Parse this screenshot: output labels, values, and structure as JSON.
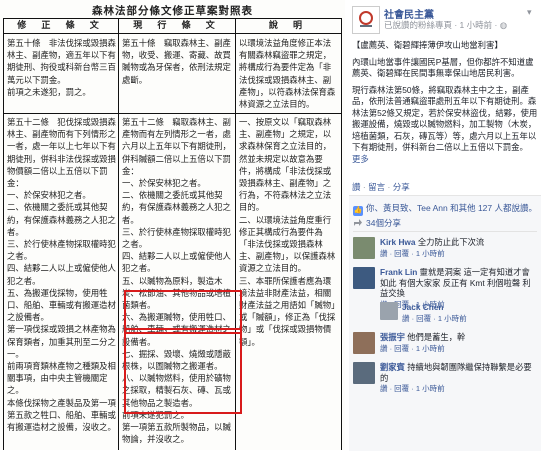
{
  "document": {
    "title": "森林法部分條文修正草案對照表",
    "headers": [
      "修 正 條 文",
      "現 行 條 文",
      "說  明"
    ],
    "row1": {
      "revised": "第五十條　非法伐採或毀損森林主、副產物，適五年以下有期徒刑、拘役或科新台幣三百萬元以下罰金。\n前項之未遂犯，罰之。",
      "current": "第五十條　竊取森林主、副產物，收受、搬運、寄藏、故買贓物或為牙保者，依刑法規定處斷。",
      "note": "以環境法益角度修正本法有關森林竊盜罪之規定，將構成行為要件定為「非法伐採或毀損森林主、副產物」，以符森林法保育森林資源之立法目的。"
    },
    "row2": {
      "revised": "第五十二條　犯伐採或毀損森林主、副產物而有下列情形之一者，處一年以上七年以下有期徒刑，併科非法伐採或毀損物價額二倍以上五倍以下罰金：\n一、於保安林犯之者。\n二、依機關之委託或其他契約，有保護森林義務之人犯之者。\n三、於行使林產物採取權時犯之者。\n四、結夥二人以上或僱使他人犯之者。\n五、為搬運伐採物，使用牲口、船舶、車輛或有搬運造材之設備者。\n第一項伐採或毀損之林產物為保育類者，加重其刑至二分之一。\n前兩項育類林產物之種類及相關事項，由中央主管機關定之。\n本條伐採物之產製品及第一項第五款之牲口、船舶、車輛或有搬運造材之設備，沒收之。",
      "current": "第五十二條　竊取森林主、副產物而有左列情形之一者，處六月以上五年以下有期徒刑，併科贓額二倍以上五倍以下罰金：\n一、於保安林犯之者。\n二、依機關之委託或其他契約，有保護森林義務之人犯之者。\n三、於行使林產物採取權時犯之者。\n四、結夥二人以上或僱使他人犯之者。\n五、以贓物為原料，製造木炭、松節油、其他物品或培植菌類者。\n六、為搬運贓物，使用牲口、船舶、車輛，或有搬運造材之設備者。\n七、掘採、毀壞、燒燬或隱蔽根株，以圖贓物之搬運者。\n八、以贓物燃料，使用於礦物之採取，精製石灰、磚、瓦或其他物品之製造者。\n前項未遂犯罰之。\n第一項第五款所製物品，以贓物論，并沒收之。",
      "note": "一、按原文以「竊取森林主、副產物」之規定，以求森林保育之立法目的，然並未規定以故意為要件，將構成「非法伐採或毀損森林主、副產物」之行為，不符森林法之立法目的。\n二、以環境法益角度重行修正其構成行為要件為「非法伐採或毀損森林主、副產物」，以保護森林資源之立法目的。\n三、本罪所保護者應為環境法益非財產法益，相關財產法益之用語如「贓物」或「贓額」，修正為「伐採物」或「伐採或毀損物價額」。"
    }
  },
  "post": {
    "page_name": "社會民主黨",
    "meta": "已說讚的粉絲專頁 · 1 小時前 · ",
    "time_icon": "globe-icon",
    "paragraphs": [
      "【盧薦英、衛碧輝捧薄伊攻山地當利害】",
      "內環山地當事件讓國民P基層，但你都許不知道盧薦英、衛碧輝在民間事無辜保山地居民利害。",
      "現行森林法第50條，將竊取森林主中之主，副產品，依刑法普通竊盜罪處刑五年以下有期徒刑。森林法第52條又規定，若於保安林盜伐，結夥，使用搬運設備，燒毀或以贓物燃料，加工製物（木炭，培植菌類，石灰，磚瓦等）等，處六月以上五年以下有期徒刑，併科新台二倍以上五倍以下罰金。"
    ],
    "more_label": "更多",
    "actions": [
      "讚",
      "留言",
      "分享"
    ],
    "likes_text": "你、黃貝致、Tee Ann 和其他 127 人都說讚。",
    "shares_text": "34個分享",
    "comments": [
      {
        "name": "Kirk Hwa",
        "text": "全力防止此下次流",
        "meta": "讚 · 回覆 · 1 小時前"
      },
      {
        "name": "Frank Lin",
        "text": "靈就是洞案 這一定有知道才會如此 有個大家家 反正有 Kmt 利個啦聲 利益交換",
        "meta": "讚 · 回覆 · 1 小時前"
      },
      {
        "name": "Jack Chen",
        "text": "",
        "meta": "讚 · 回覆 · 1 小時前"
      },
      {
        "name": "張振宇",
        "text": "他們是蓄生，幹",
        "meta": "讚 · 回覆 · 1 小時前"
      },
      {
        "name": "劉家賓",
        "text": "持續地與韌團隊繼保持聯繫是必要的",
        "meta": "讚 · 回覆 · 1 小時前"
      }
    ]
  }
}
